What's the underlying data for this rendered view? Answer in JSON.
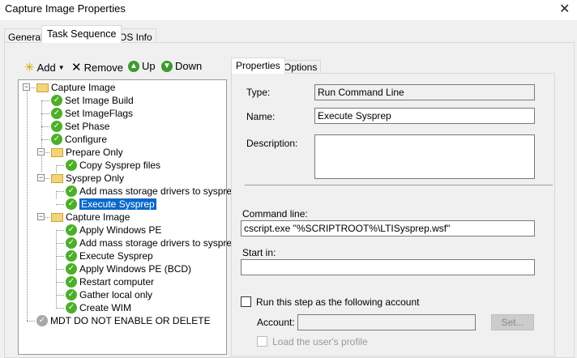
{
  "window": {
    "title": "Capture Image Properties",
    "close": "✕"
  },
  "tabs": [
    "General",
    "Task Sequence",
    "OS Info"
  ],
  "toolbar": {
    "add": "Add",
    "remove": "Remove",
    "up": "Up",
    "down": "Down"
  },
  "tree": [
    {
      "label": "Capture Image",
      "level": 0,
      "type": "group"
    },
    {
      "label": "Set Image Build",
      "level": 1,
      "type": "step"
    },
    {
      "label": "Set ImageFlags",
      "level": 1,
      "type": "step"
    },
    {
      "label": "Set Phase",
      "level": 1,
      "type": "step"
    },
    {
      "label": "Configure",
      "level": 1,
      "type": "step"
    },
    {
      "label": "Prepare Only",
      "level": 1,
      "type": "group"
    },
    {
      "label": "Copy Sysprep files",
      "level": 2,
      "type": "step"
    },
    {
      "label": "Sysprep Only",
      "level": 1,
      "type": "group"
    },
    {
      "label": "Add mass storage drivers to sysprep.inf",
      "level": 2,
      "type": "step"
    },
    {
      "label": "Execute Sysprep",
      "level": 2,
      "type": "step",
      "selected": true
    },
    {
      "label": "Capture Image",
      "level": 1,
      "type": "group"
    },
    {
      "label": "Apply Windows PE",
      "level": 2,
      "type": "step"
    },
    {
      "label": "Add mass storage drivers to sysprep.inf",
      "level": 2,
      "type": "step"
    },
    {
      "label": "Execute Sysprep",
      "level": 2,
      "type": "step"
    },
    {
      "label": "Apply Windows PE (BCD)",
      "level": 2,
      "type": "step"
    },
    {
      "label": "Restart computer",
      "level": 2,
      "type": "step"
    },
    {
      "label": "Gather local only",
      "level": 2,
      "type": "step"
    },
    {
      "label": "Create WIM",
      "level": 2,
      "type": "step"
    },
    {
      "label": "MDT DO NOT ENABLE OR DELETE",
      "level": 0,
      "type": "disabled"
    }
  ],
  "props": {
    "tabs": [
      "Properties",
      "Options"
    ],
    "type_label": "Type:",
    "type_value": "Run Command Line",
    "name_label": "Name:",
    "name_value": "Execute Sysprep",
    "desc_label": "Description:",
    "desc_value": "",
    "cmd_label": "Command line:",
    "cmd_value": "cscript.exe \"%SCRIPTROOT%\\LTISysprep.wsf\"",
    "start_label": "Start in:",
    "start_value": "",
    "runas_label": "Run this step as the following account",
    "account_label": "Account:",
    "account_value": "",
    "set_button": "Set...",
    "load_profile_label": "Load the user's profile"
  }
}
